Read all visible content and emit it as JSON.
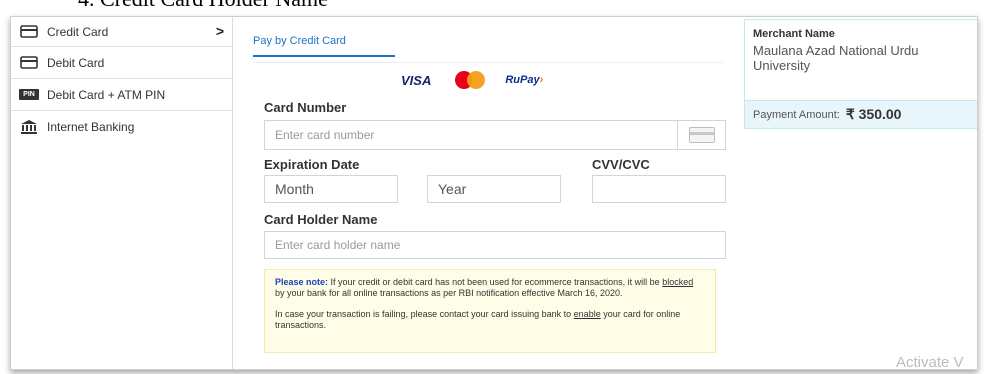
{
  "document": {
    "heading": "4.   Credit Card Holder Name"
  },
  "sidebar": {
    "items": [
      {
        "label": "Credit Card",
        "icon": "credit-card-icon",
        "active": true
      },
      {
        "label": "Debit Card",
        "icon": "debit-card-icon"
      },
      {
        "label": "Debit Card + ATM PIN",
        "icon": "pin-icon",
        "icon_text": "PIN"
      },
      {
        "label": "Internet Banking",
        "icon": "bank-icon"
      }
    ],
    "chevron": ">"
  },
  "main": {
    "tab": "Pay by Credit Card",
    "brands": {
      "visa": "VISA",
      "rupay": "RuPay",
      "rupay_mark": "›"
    },
    "card_number": {
      "label": "Card Number",
      "placeholder": "Enter card number"
    },
    "expiration": {
      "label": "Expiration Date",
      "month_placeholder": "Month",
      "year_placeholder": "Year"
    },
    "cvv": {
      "label": "CVV/CVC"
    },
    "holder": {
      "label": "Card Holder Name",
      "placeholder": "Enter card holder name"
    },
    "note": {
      "title": "Please note:",
      "line1_a": " If your credit or debit card has not been used for ecommerce transactions, it will be ",
      "line1_u": "blocked",
      "line1_b": " by your bank for all online transactions as per RBI notification effective March 16, 2020.",
      "line2_a": "In case your transaction is failing, please contact your card issuing bank to ",
      "line2_u": "enable",
      "line2_b": " your card for online transactions."
    }
  },
  "merchant": {
    "title": "Merchant Name",
    "name": "Maulana Azad National Urdu University",
    "amount_label": "Payment Amount:",
    "amount": "₹ 350.00"
  },
  "watermark": "Activate V",
  "colors": {
    "accent": "#1a73c8",
    "note_bg": "#fffde8",
    "merchant_bg": "#e8f6fc"
  }
}
